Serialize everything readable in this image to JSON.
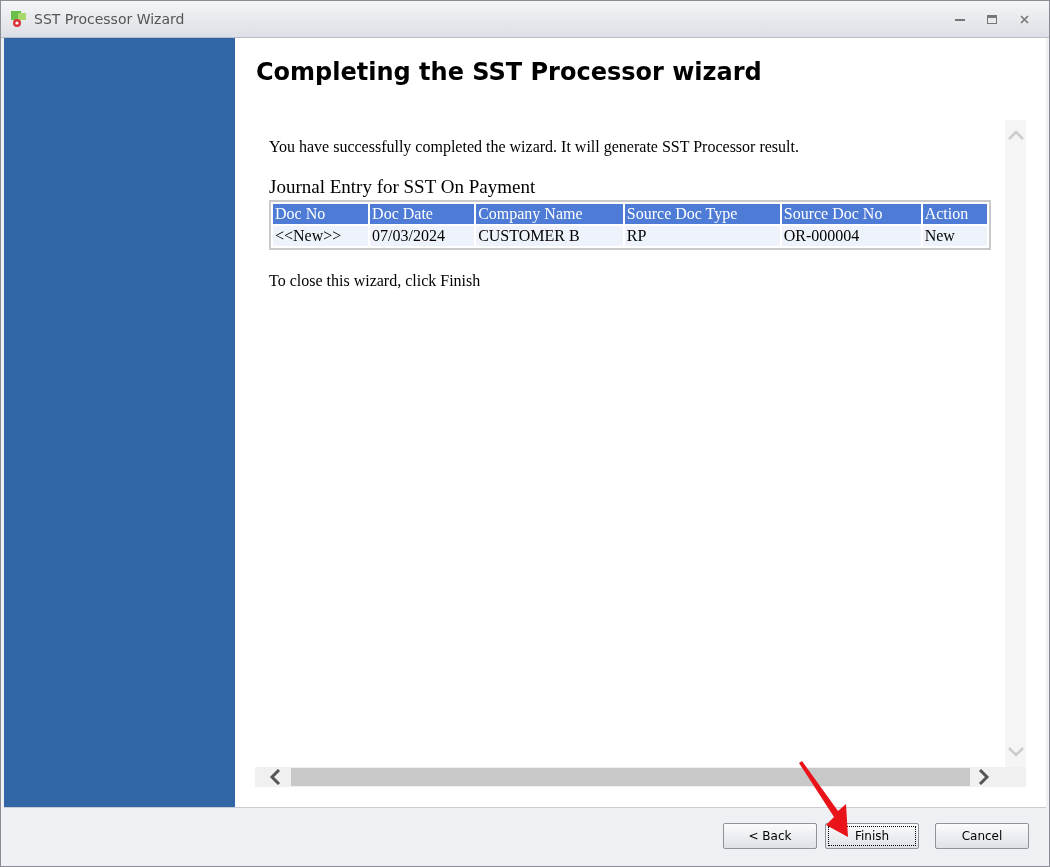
{
  "window": {
    "title": "SST Processor Wizard"
  },
  "heading": "Completing the SST Processor wizard",
  "intro": "You have successfully completed the wizard. It will generate SST Processor result.",
  "table": {
    "title": "Journal Entry for SST On Payment",
    "columns": [
      "Doc No",
      "Doc Date",
      "Company Name",
      "Source Doc Type",
      "Source Doc No",
      "Action"
    ],
    "rows": [
      [
        "<<New>>",
        "07/03/2024",
        "CUSTOMER B",
        "RP",
        "OR-000004",
        "New"
      ]
    ]
  },
  "closing": "To close this wizard, click Finish",
  "buttons": [
    {
      "label": "< Back",
      "focused": false
    },
    {
      "label": "Finish",
      "focused": true
    },
    {
      "label": "Cancel",
      "focused": false
    }
  ]
}
